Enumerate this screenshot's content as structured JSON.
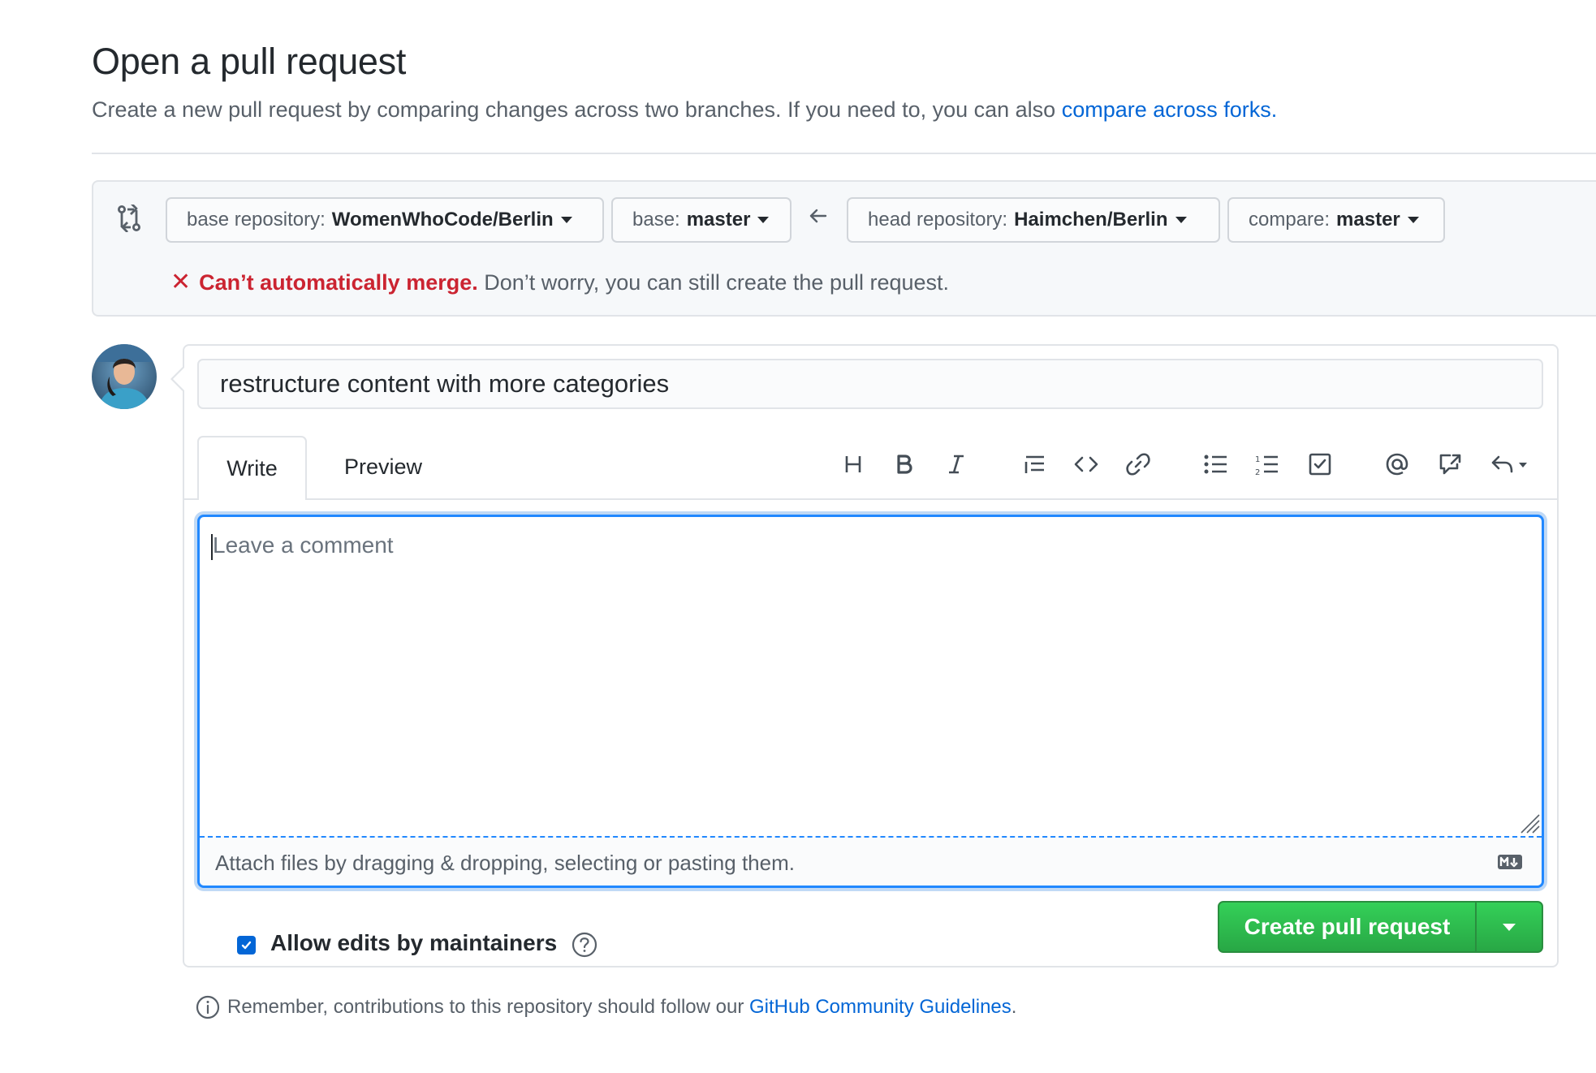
{
  "header": {
    "title": "Open a pull request",
    "subtitle": "Create a new pull request by comparing changes across two branches. If you need to, you can also",
    "subtitle_link": "compare across forks."
  },
  "compare": {
    "base_repo_label": "base repository:",
    "base_repo_value": "WomenWhoCode/Berlin",
    "base_label": "base:",
    "base_value": "master",
    "head_repo_label": "head repository:",
    "head_repo_value": "Haimchen/Berlin",
    "compare_label": "compare:",
    "compare_value": "master",
    "merge_status": "Can’t automatically merge.",
    "merge_note": "Don’t worry, you can still create the pull request."
  },
  "form": {
    "title_value": "restructure content with more categories",
    "tabs": [
      "Write",
      "Preview"
    ],
    "comment_placeholder": "Leave a comment",
    "attach_text": "Attach files by dragging & dropping, selecting or pasting them.",
    "allow_edits_label": "Allow edits by maintainers",
    "allow_edits_checked": true,
    "create_button": "Create pull request"
  },
  "footer": {
    "text": "Remember, contributions to this repository should follow our",
    "link": "GitHub Community Guidelines",
    "end": "."
  },
  "colors": {
    "link": "#0366d6",
    "error": "#cb2431",
    "primary_button": "#28a745",
    "focus": "#2188ff"
  }
}
